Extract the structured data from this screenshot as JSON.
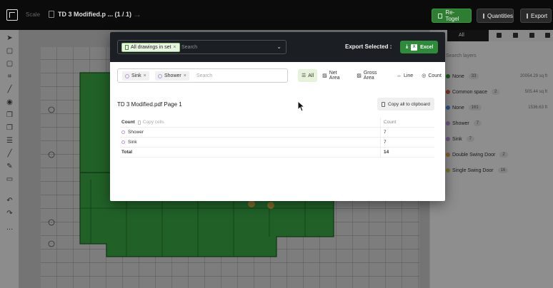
{
  "topbar": {
    "scale_label": "Scale",
    "doc_title": "TD 3 Modified.p ... (1 / 1)",
    "nav_prev": "←",
    "nav_next": "→",
    "retogel_label": "Re-Togel",
    "quantities_label": "Quantities",
    "export_label": "Export"
  },
  "right_panel": {
    "tab_all": "All",
    "search_placeholder": "Search layers",
    "layers": [
      {
        "name": "None",
        "count": "33",
        "value": "20054.29 sq ft",
        "color": "#2e9a3a"
      },
      {
        "name": "Common space",
        "count": "2",
        "value": "505.44 sq ft",
        "color": "#e0554a"
      },
      {
        "name": "None",
        "count": "161",
        "value": "1536.63 ft",
        "color": "#4f8fe0"
      },
      {
        "name": "Shower",
        "count": "7",
        "value": "",
        "color": "#b79bd8"
      },
      {
        "name": "Sink",
        "count": "7",
        "value": "",
        "color": "#b79bd8"
      },
      {
        "name": "Double Swing Door",
        "count": "2",
        "value": "",
        "color": "#e8a74a"
      },
      {
        "name": "Single Swing Door",
        "count": "16",
        "value": "",
        "color": "#cfcf50"
      }
    ]
  },
  "modal": {
    "drawing_chip": "All drawings in set",
    "drawing_search_placeholder": "Search",
    "export_selected": "Export Selected :",
    "excel_label": "Excel",
    "filter_chips": [
      "Sink",
      "Shower"
    ],
    "filter_search_placeholder": "Search",
    "filter_tabs": [
      {
        "label": "All",
        "active": true
      },
      {
        "label": "Net Area",
        "active": false
      },
      {
        "label": "Gross Area",
        "active": false
      },
      {
        "label": "Line",
        "active": false
      },
      {
        "label": "Count",
        "active": false
      }
    ],
    "page_title": "TD 3 Modified.pdf Page 1",
    "copy_all": "Copy all to clipboard",
    "table": {
      "header_name": "Count",
      "copy_cells": "Copy cells",
      "header_value": "Count",
      "rows": [
        {
          "name": "Shower",
          "value": "7"
        },
        {
          "name": "Sink",
          "value": "7"
        }
      ],
      "total_label": "Total",
      "total_value": "14"
    }
  },
  "colors": {
    "accent_green": "#2e8b3a",
    "modal_header": "#1b1e22",
    "plan_fill": "#39a845"
  }
}
